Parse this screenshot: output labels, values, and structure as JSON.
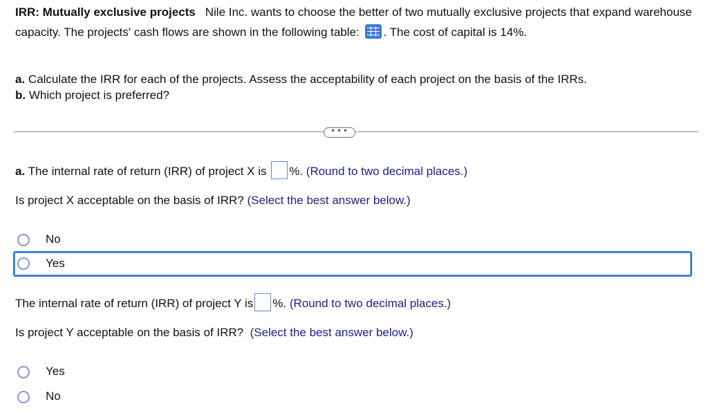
{
  "problem": {
    "title": "IRR: Mutually exclusive projects",
    "text_part1": "Nile Inc. wants to choose the better of two mutually exclusive projects that expand warehouse capacity.  The projects' cash flows are shown in the following table:",
    "table_icon": "table-grid-icon",
    "text_part2": ".  The cost of capital is 14%.",
    "part_a": {
      "label": "a.",
      "text": "Calculate the IRR for each of the projects. Assess the acceptability of each project on the basis of the IRRs."
    },
    "part_b": {
      "label": "b.",
      "text": "Which project is preferred?"
    }
  },
  "divider": {
    "more_button_label": "• • •"
  },
  "question_x": {
    "label": "a.",
    "text_before": "The internal rate of return (IRR) of project X is",
    "answer_value": "",
    "text_after": "%.",
    "hint": "(Round to two decimal places.)",
    "accept_question": "Is project X acceptable on the basis of IRR?",
    "accept_hint": "(Select the best answer below.)",
    "options": [
      {
        "label": "No",
        "selected": false,
        "focused": false
      },
      {
        "label": "Yes",
        "selected": false,
        "focused": true
      }
    ]
  },
  "question_y": {
    "text_before": "The internal rate of return (IRR) of project Y is",
    "answer_value": "",
    "text_after": "%.",
    "hint": "(Round to two decimal places.)",
    "accept_question": "Is project Y acceptable on the basis of IRR?",
    "accept_hint": "(Select the best answer below.)",
    "options": [
      {
        "label": "Yes",
        "selected": false
      },
      {
        "label": "No",
        "selected": false
      }
    ]
  },
  "colors": {
    "hint": "#1b1f8a",
    "focus_border": "#2f7cc6",
    "radio_border": "#8a93d0",
    "table_icon": "#3b7bd9"
  }
}
